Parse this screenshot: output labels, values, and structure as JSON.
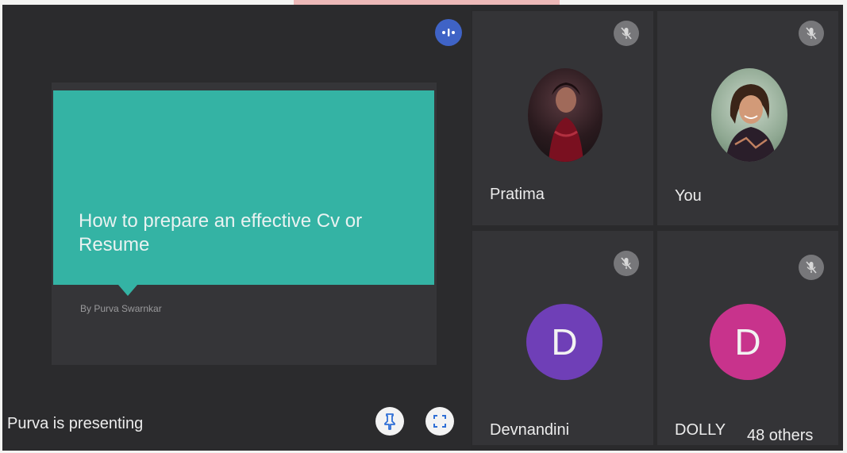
{
  "presentation": {
    "slide_title": "How to prepare an effective Cv or Resume",
    "slide_author": "By Purva Swarnkar",
    "presenting_label": "Purva is presenting",
    "icons": {
      "audio": "audio-level-icon",
      "pin": "pin-icon",
      "fullscreen": "fullscreen-icon"
    }
  },
  "participants": [
    {
      "name": "Pratima",
      "avatar_type": "photo",
      "muted": true
    },
    {
      "name": "You",
      "avatar_type": "photo",
      "muted": true
    },
    {
      "name": "Devnandini",
      "avatar_type": "letter",
      "initial": "D",
      "color": "#6f3fb7",
      "muted": true
    },
    {
      "name": "DOLLY",
      "avatar_type": "letter",
      "initial": "D",
      "color": "#c8338c",
      "muted": true
    }
  ],
  "others_label": "48 others",
  "colors": {
    "slide_accent": "#34b3a4",
    "audio_indicator": "#3f63c6",
    "background": "#2a2a2c"
  }
}
